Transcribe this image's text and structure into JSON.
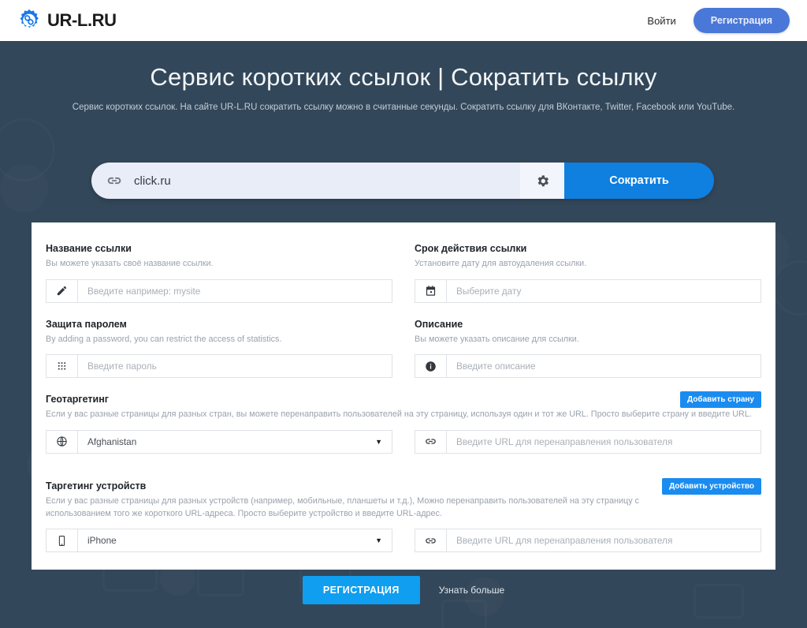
{
  "header": {
    "brand_name": "UR-L.RU",
    "logo_icon": "gear-link-logo",
    "login_label": "Войти",
    "register_label": "Регистрация"
  },
  "hero": {
    "title": "Сервис коротких ссылок | Сократить ссылку",
    "subtitle": "Сервис коротких ссылок. На сайте UR-L.RU сократить ссылку можно в считанные секунды. Сократить ссылку для ВКонтакте, Twitter, Facebook или YouTube."
  },
  "shorten_bar": {
    "link_icon": "link-icon",
    "url_value": "click.ru",
    "gear_icon": "gear-icon",
    "button_label": "Сократить"
  },
  "form": {
    "link_name": {
      "title": "Название ссылки",
      "description": "Вы можете указать своё название ссылки.",
      "icon": "pencil-icon",
      "placeholder": "Введите например: mysite"
    },
    "expiry": {
      "title": "Срок действия ссылки",
      "description": "Установите дату для автоудаления ссылки.",
      "icon": "calendar-icon",
      "placeholder": "Выберите дату"
    },
    "password": {
      "title": "Защита паролем",
      "description": "By adding a password, you can restrict the access of statistics.",
      "icon": "keypad-icon",
      "placeholder": "Введите пароль"
    },
    "description_field": {
      "title": "Описание",
      "description": "Вы можете указать описание для ссылки.",
      "icon": "info-icon",
      "placeholder": "Введите описание"
    },
    "geo": {
      "title": "Геотаргетинг",
      "description": "Если у вас разные страницы для разных стран, вы можете перенаправить пользователей на эту страницу, используя один и тот же URL. Просто выберите страну и введите URL.",
      "add_button": "Добавить страну",
      "select_icon": "globe-icon",
      "selected_country": "Afghanistan",
      "caret": "▼",
      "url_icon": "link-icon",
      "url_placeholder": "Введите URL для перенаправления пользователя"
    },
    "device": {
      "title": "Таргетинг устройств",
      "description": "Если у вас разные страницы для разных устройств (например, мобильные, планшеты и т.д.), Можно перенаправить пользователей на эту страницу с использованием того же короткого URL-адреса. Просто выберите устройство и введите URL-адрес.",
      "add_button": "Добавить устройство",
      "select_icon": "mobile-icon",
      "selected_device": "iPhone",
      "caret": "▼",
      "url_icon": "link-icon",
      "url_placeholder": "Введите URL для перенаправления пользователя"
    }
  },
  "footer": {
    "register_label": "РЕГИСТРАЦИЯ",
    "more_label": "Узнать больше"
  },
  "colors": {
    "background": "#33475a",
    "accent_blue": "#0f7fe0",
    "bright_blue": "#1a8cf0",
    "header_button_blue": "#4a78d8",
    "card_white": "#ffffff",
    "input_lavender": "#e8edf8"
  }
}
